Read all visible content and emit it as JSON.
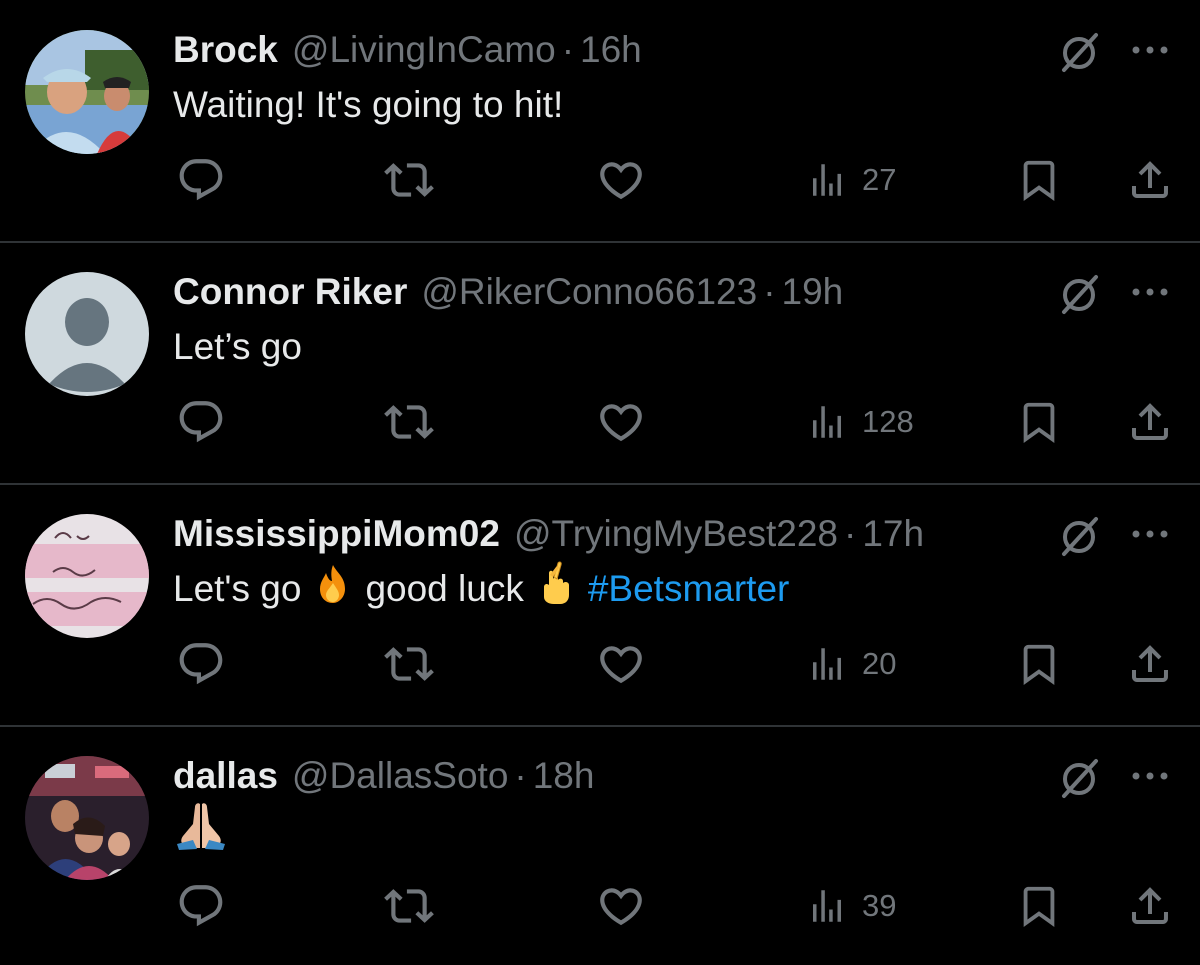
{
  "tweets": [
    {
      "name": "Brock",
      "handle": "@LivingInCamo",
      "separator": "·",
      "time": "16h",
      "text": "Waiting! It's going to hit!",
      "views": "27",
      "avatar": "family-photo-golfcart"
    },
    {
      "name": "Connor Riker",
      "handle": "@RikerConno66123",
      "separator": "·",
      "time": "19h",
      "text": "Let’s go",
      "views": "128",
      "avatar": "default-profile-silhouette"
    },
    {
      "name": "MississippiMom02",
      "handle": "@TryingMyBest228",
      "separator": "·",
      "time": "17h",
      "text_parts": [
        "Let's go",
        "good luck",
        "#Betsmarter"
      ],
      "emojis": [
        "fire-emoji",
        "crossed-fingers-emoji"
      ],
      "views": "20",
      "avatar": "pray-text-graphic"
    },
    {
      "name": "dallas",
      "handle": "@DallasSoto",
      "separator": "·",
      "time": "18h",
      "emojis": [
        "folded-hands-emoji"
      ],
      "views": "39",
      "avatar": "family-selfie"
    }
  ],
  "colors": {
    "background": "#000000",
    "text_primary": "#e7e9ea",
    "text_secondary": "#71767b",
    "divider": "#2f3336",
    "hashtag": "#1d9bf0"
  },
  "icons": [
    "reply-icon",
    "retweet-icon",
    "like-icon",
    "views-icon",
    "bookmark-icon",
    "share-icon",
    "grok-icon",
    "more-icon"
  ]
}
